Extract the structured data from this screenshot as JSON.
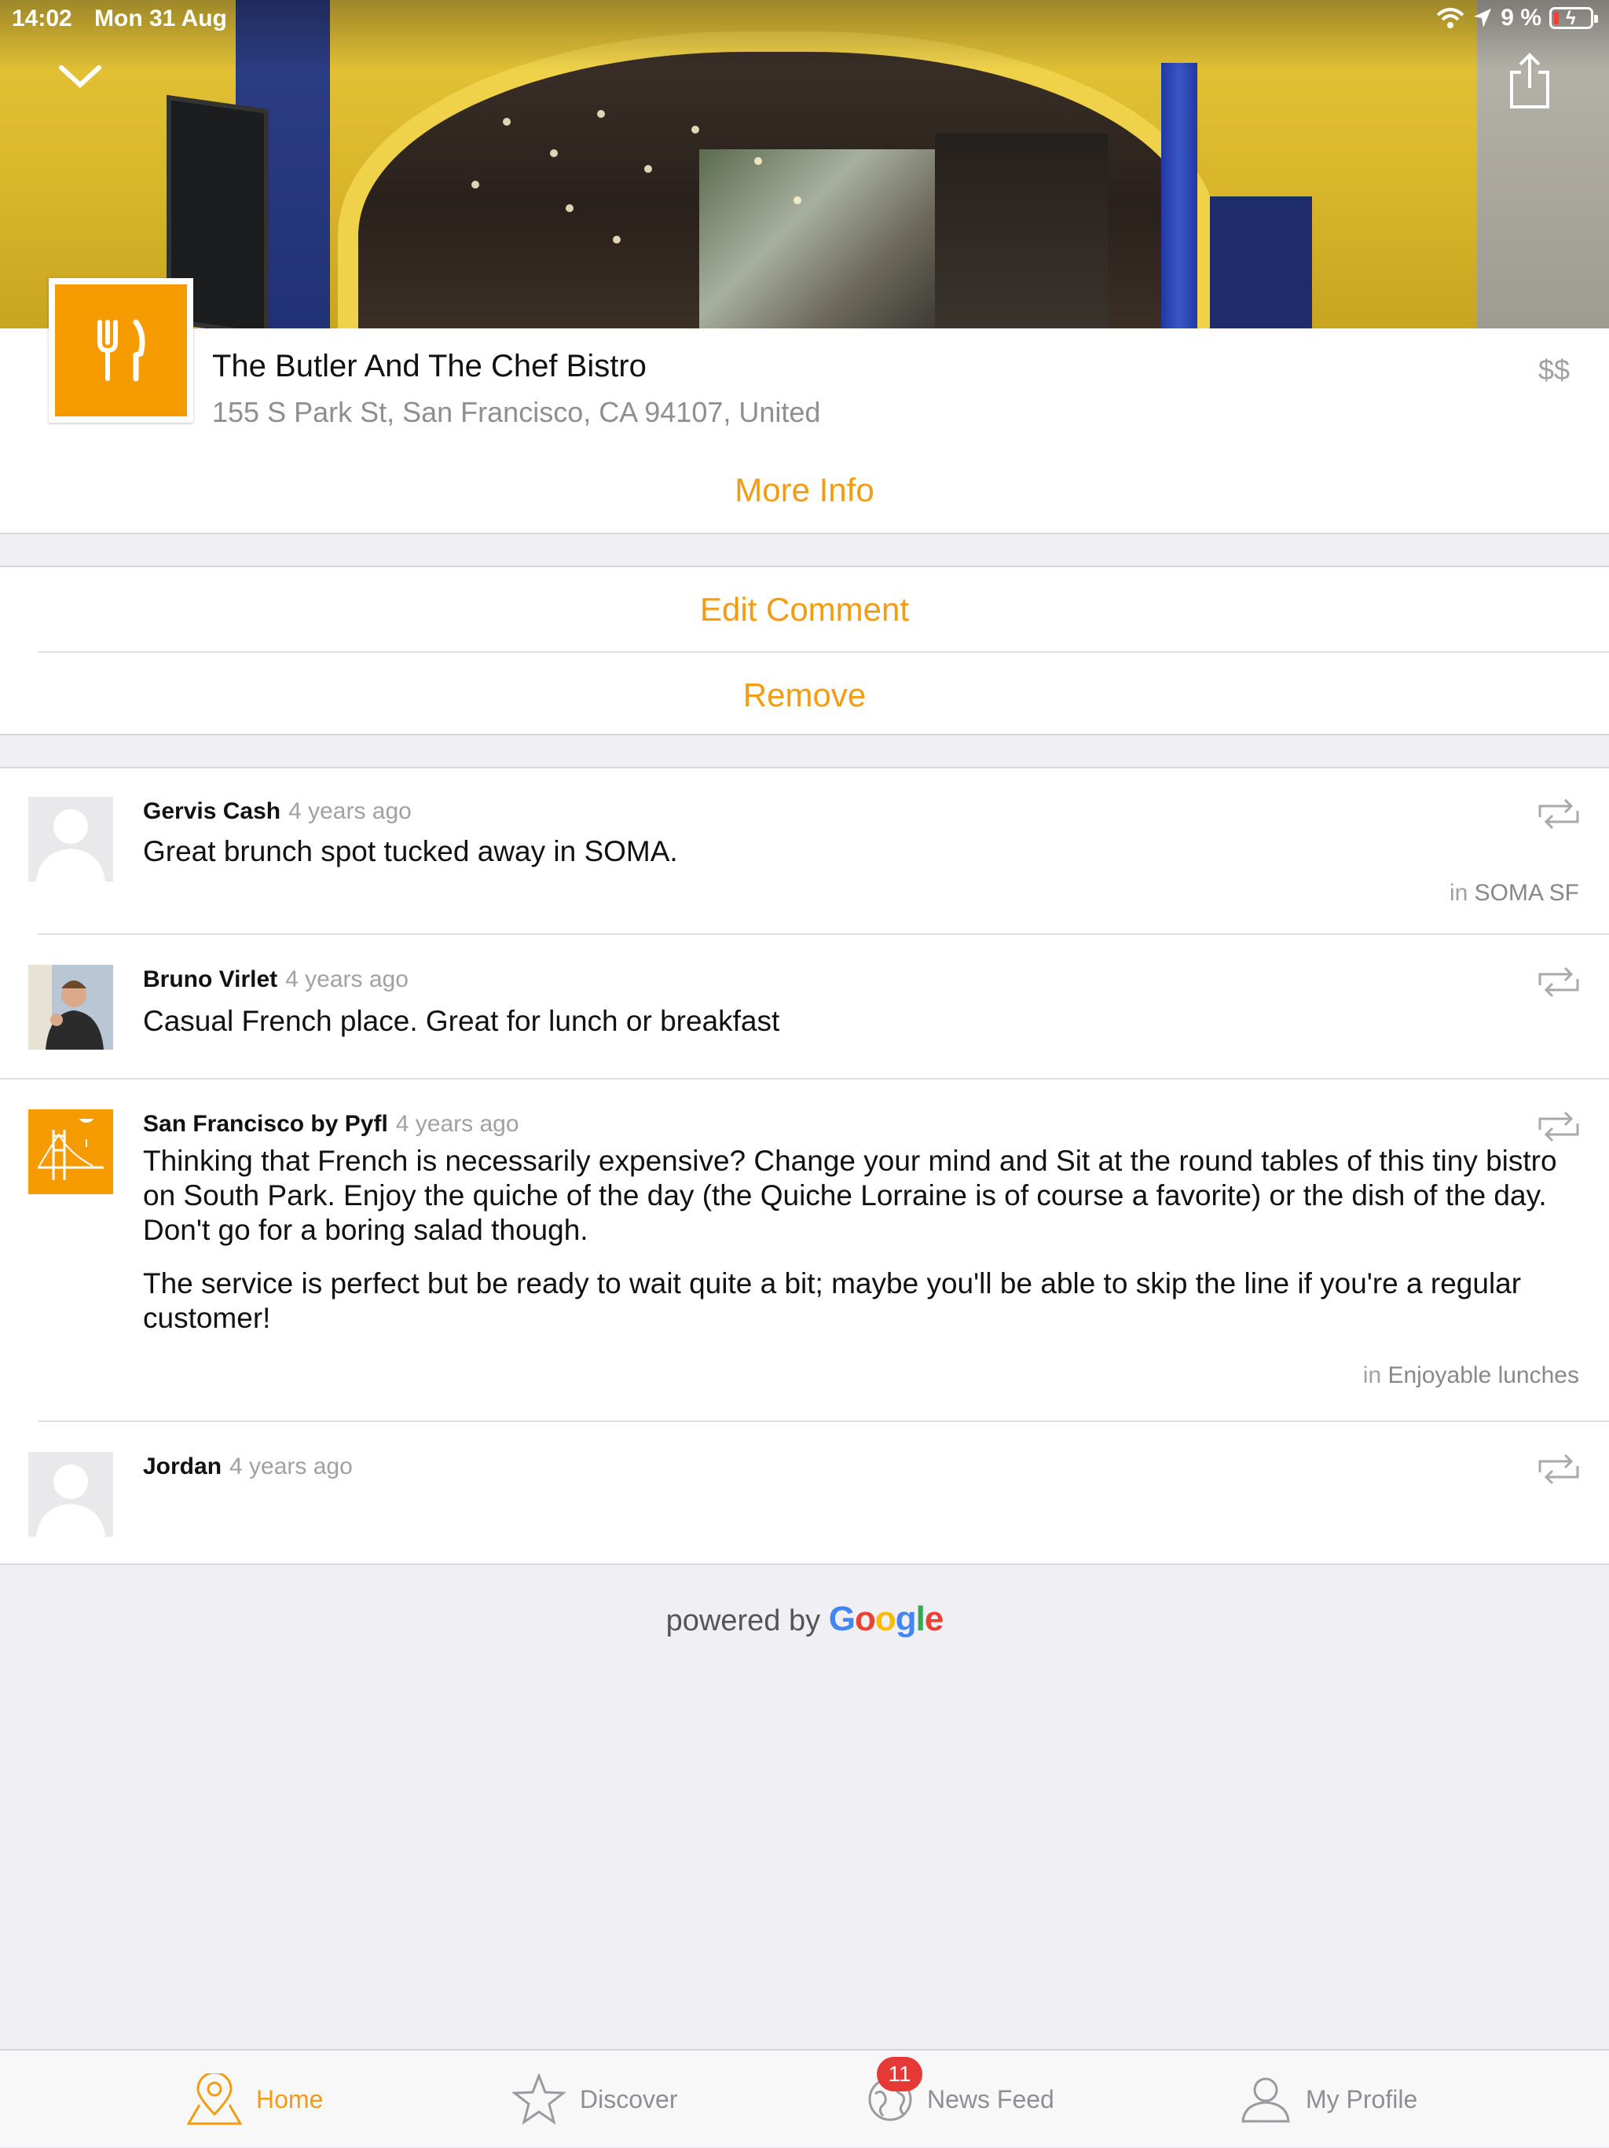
{
  "status_bar": {
    "time": "14:02",
    "date": "Mon 31 Aug",
    "battery": "9 %"
  },
  "place": {
    "name": "The Butler And The Chef Bistro",
    "address": "155 S Park St, San Francisco, CA 94107, United",
    "price": "$$",
    "more_info": "More Info"
  },
  "actions": {
    "edit_comment": "Edit Comment",
    "remove": "Remove"
  },
  "comments": [
    {
      "author": "Gervis Cash",
      "ago": "4 years ago",
      "text": "Great brunch spot tucked away in SOMA.",
      "list_prefix": "in",
      "list_name": "SOMA SF"
    },
    {
      "author": "Bruno Virlet",
      "ago": "4 years ago",
      "text": "Casual French place. Great for lunch or breakfast"
    },
    {
      "author": "San Francisco by Pyfl",
      "ago": "4 years ago",
      "text_p1": "Thinking that French is necessarily expensive? Change your mind and Sit at the round tables of this tiny bistro on South Park. Enjoy the quiche of the day (the Quiche Lorraine is of course a favorite) or the dish of the day. Don't go for a boring salad though.",
      "text_p2": "The service is perfect but be ready to wait quite a bit; maybe you'll be able to skip the line if you're a regular customer!",
      "list_prefix": "in",
      "list_name": "Enjoyable lunches"
    },
    {
      "author": "Jordan",
      "ago": "4 years ago"
    }
  ],
  "footer": {
    "powered_by": "powered by",
    "google": [
      "G",
      "o",
      "o",
      "g",
      "l",
      "e"
    ]
  },
  "tabs": [
    {
      "label": "Home",
      "icon": "map-pin-icon"
    },
    {
      "label": "Discover",
      "icon": "star-icon"
    },
    {
      "label": "News Feed",
      "icon": "globe-icon",
      "badge": "11"
    },
    {
      "label": "My Profile",
      "icon": "person-icon"
    }
  ],
  "colors": {
    "accent": "#f39c12",
    "place_icon": "#f59b00",
    "badge": "#e53935"
  }
}
